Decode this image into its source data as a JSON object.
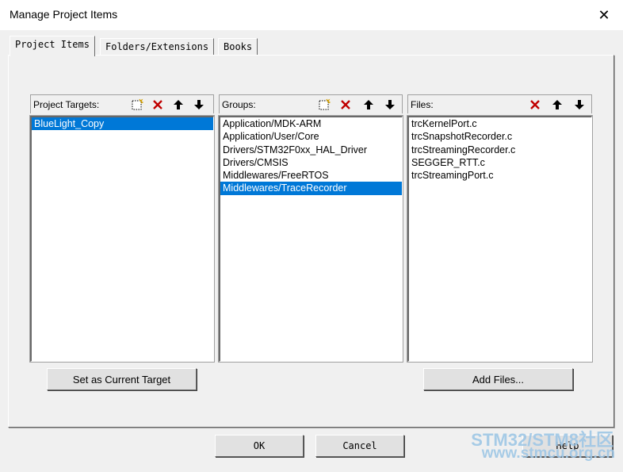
{
  "window": {
    "title": "Manage Project Items",
    "close_glyph": "✕"
  },
  "tabs": [
    {
      "label": "Project Items",
      "active": true
    },
    {
      "label": "Folders/Extensions",
      "active": false
    },
    {
      "label": "Books",
      "active": false
    }
  ],
  "targets": {
    "header": "Project Targets:",
    "items": [
      "BlueLight_Copy"
    ],
    "selected_index": 0,
    "tool_icons": [
      "new-item-icon",
      "delete-icon",
      "move-up-icon",
      "move-down-icon"
    ]
  },
  "groups": {
    "header": "Groups:",
    "items": [
      "Application/MDK-ARM",
      "Application/User/Core",
      "Drivers/STM32F0xx_HAL_Driver",
      "Drivers/CMSIS",
      "Middlewares/FreeRTOS",
      "Middlewares/TraceRecorder"
    ],
    "selected_index": 5,
    "tool_icons": [
      "new-item-icon",
      "delete-icon",
      "move-up-icon",
      "move-down-icon"
    ]
  },
  "files": {
    "header": "Files:",
    "items": [
      "trcKernelPort.c",
      "trcSnapshotRecorder.c",
      "trcStreamingRecorder.c",
      "SEGGER_RTT.c",
      "trcStreamingPort.c"
    ],
    "tool_icons": [
      "delete-icon",
      "move-up-icon",
      "move-down-icon"
    ]
  },
  "buttons": {
    "set_current_target": "Set as Current Target",
    "add_files": "Add Files...",
    "ok": "OK",
    "cancel": "Cancel",
    "help": "Help"
  },
  "watermark": {
    "line1": "STM32/STM8社区",
    "line2": "www.stmcu.org.cn"
  },
  "colors": {
    "selection": "#0078d7",
    "delete_red": "#c00000",
    "watermark": "#9fc7e6"
  }
}
